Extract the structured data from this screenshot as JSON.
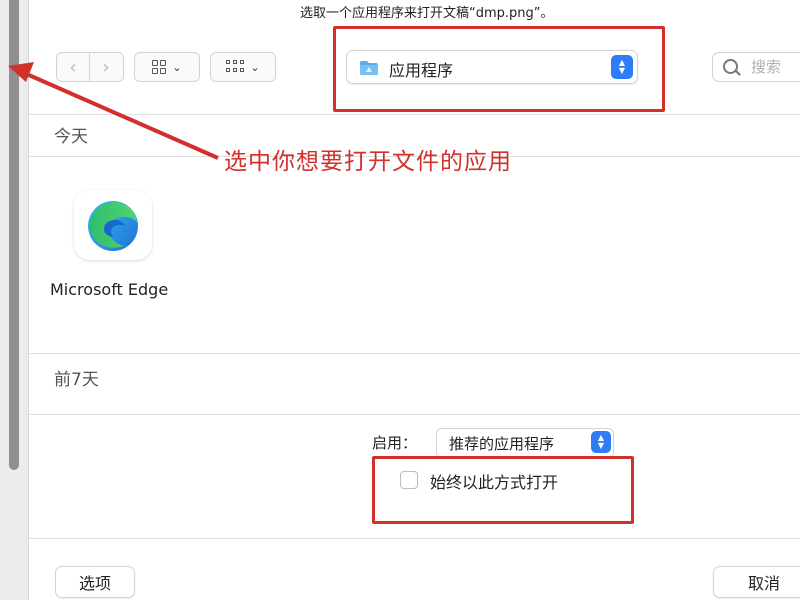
{
  "dialog": {
    "title": "选取一个应用程序来打开文稿“dmp.png”。"
  },
  "toolbar": {
    "back_icon": "chevron-left-icon",
    "forward_icon": "chevron-right-icon",
    "view_grid_icon": "grid-view-icon",
    "view_list_icon": "list-view-icon",
    "location_label": "应用程序",
    "search_placeholder": "搜索"
  },
  "sections": [
    {
      "header": "今天",
      "apps": [
        {
          "name": "Microsoft Edge",
          "icon": "edge-icon"
        }
      ]
    },
    {
      "header": "前7天",
      "apps": []
    }
  ],
  "enable": {
    "label": "启用：",
    "value": "推荐的应用程序"
  },
  "always_open": {
    "label": "始终以此方式打开",
    "checked": false
  },
  "buttons": {
    "options": "选项",
    "cancel": "取消"
  },
  "annotation": {
    "text": "选中你想要打开文件的应用",
    "color": "#d1302b"
  },
  "colors": {
    "accent": "#2f7df6",
    "annotation_red": "#d1302b"
  }
}
